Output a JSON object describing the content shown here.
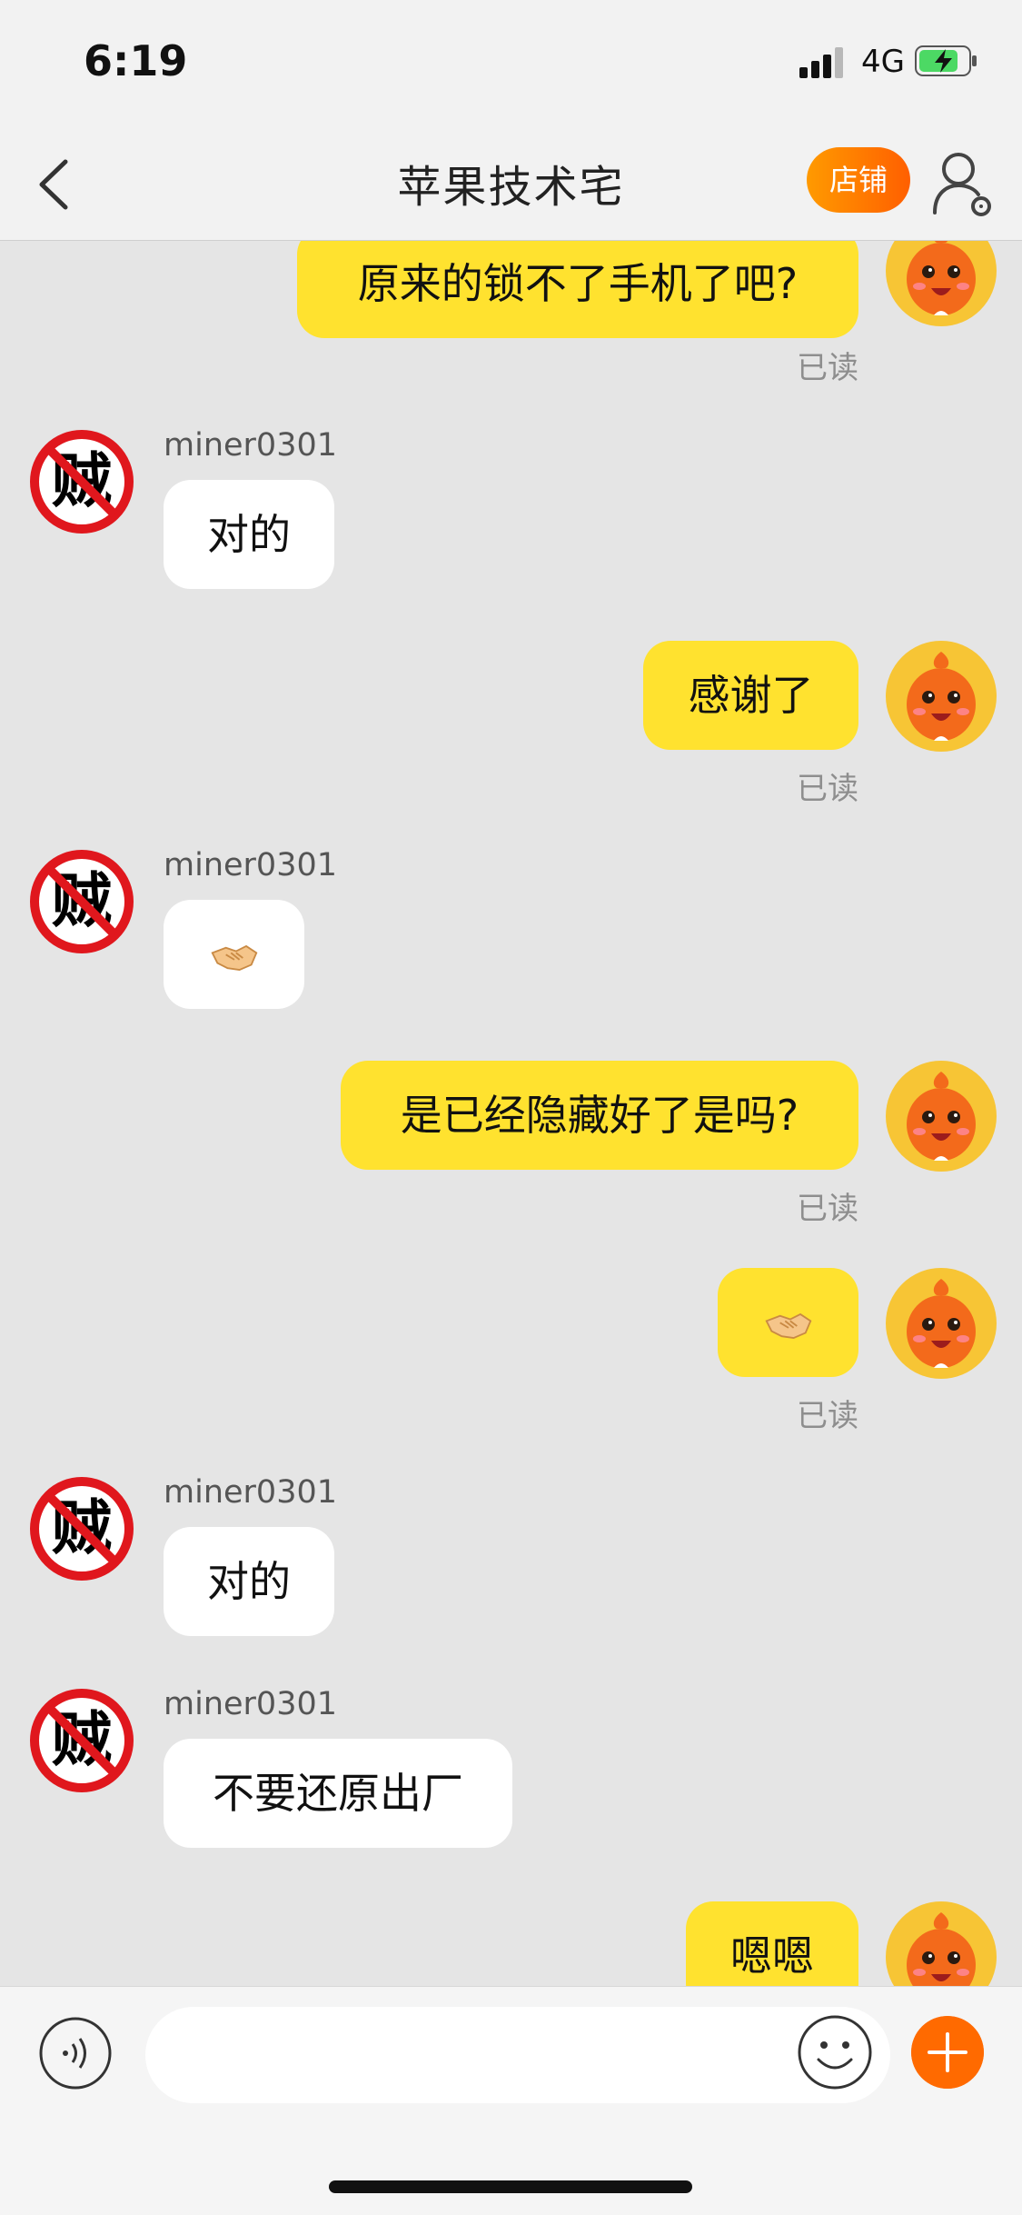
{
  "status": {
    "time": "6:19",
    "network": "4G"
  },
  "header": {
    "title": "苹果技术宅",
    "shop_label": "店铺"
  },
  "messages": [
    {
      "side": "right",
      "text": "原来的锁不了手机了吧?",
      "read": "已读"
    },
    {
      "side": "left",
      "sender": "miner0301",
      "text": "对的"
    },
    {
      "side": "right",
      "text": "感谢了",
      "read": "已读"
    },
    {
      "side": "left",
      "sender": "miner0301",
      "emoji": "handshake-icon"
    },
    {
      "side": "right",
      "text": "是已经隐藏好了是吗?",
      "read": "已读"
    },
    {
      "side": "right",
      "emoji": "handshake-icon",
      "read": "已读"
    },
    {
      "side": "left",
      "sender": "miner0301",
      "text": "对的"
    },
    {
      "side": "left",
      "sender": "miner0301",
      "text": "不要还原出厂"
    },
    {
      "side": "right",
      "text": "嗯嗯"
    }
  ],
  "input": {
    "placeholder": ""
  },
  "colors": {
    "accent": "#ff6a00",
    "my_bubble": "#ffe22f",
    "their_bubble": "#ffffff",
    "background": "#e5e5e5"
  }
}
